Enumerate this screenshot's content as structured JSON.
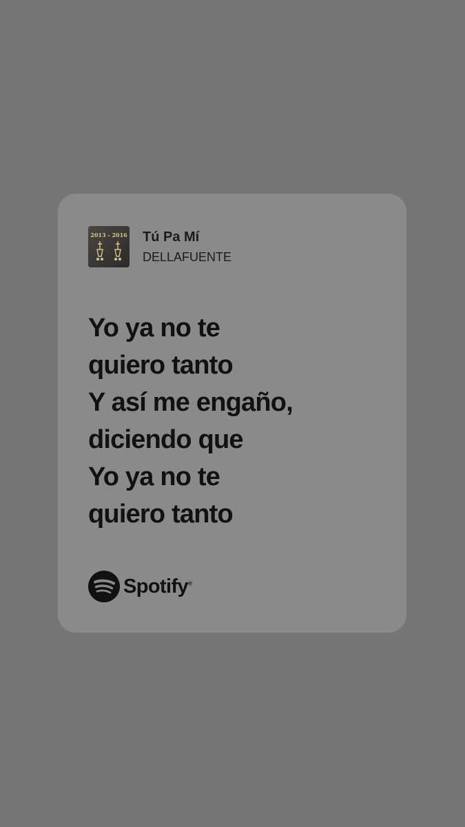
{
  "share_card": {
    "track": {
      "title": "Tú Pa Mí",
      "artist": "DELLAFUENTE",
      "album_art_icon": "album-cover-image",
      "album_art_text": "2013 - 2016"
    },
    "lyrics": [
      "Yo ya no te",
      "quiero tanto",
      "Y así me engaño,",
      "diciendo que",
      "Yo ya no te",
      "quiero tanto"
    ],
    "brand": {
      "name": "Spotify",
      "trademark": "®",
      "icon": "spotify-logo-icon"
    }
  },
  "colors": {
    "background": "#757575",
    "card": "#8a8a8a",
    "text": "#111111"
  }
}
